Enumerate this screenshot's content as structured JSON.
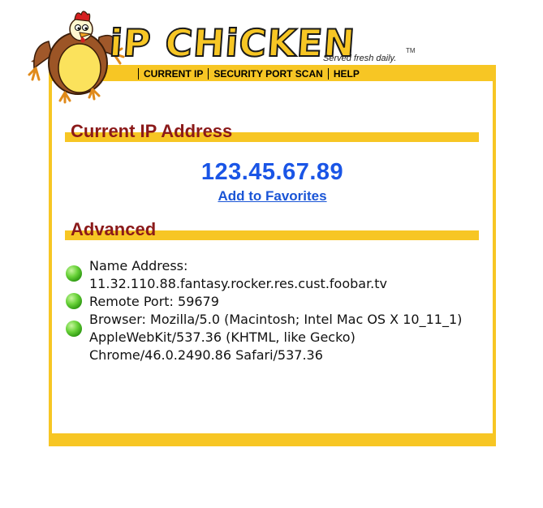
{
  "brand": {
    "wordmark": "iP CHiCKEN",
    "tagline": "Served fresh daily.",
    "trademark": "TM"
  },
  "nav": {
    "items": [
      "CURRENT IP",
      "SECURITY PORT SCAN",
      "HELP"
    ]
  },
  "current_ip": {
    "heading": "Current IP Address",
    "value": "123.45.67.89",
    "favorites_link": "Add to Favorites"
  },
  "advanced": {
    "heading": "Advanced",
    "name_address_label": "Name Address:",
    "name_address_value": "11.32.110.88.fantasy.rocker.res.cust.foobar.tv",
    "remote_port": "Remote Port: 59679",
    "browser": "Browser: Mozilla/5.0 (Macintosh; Intel Mac OS X 10_11_1) AppleWebKit/537.36 (KHTML, like Gecko) Chrome/46.0.2490.86 Safari/537.36"
  },
  "colors": {
    "brand_yellow": "#f7c624",
    "heading_red": "#8b1a1a",
    "ip_blue": "#1a55e6",
    "bullet_green": "#4cc021"
  },
  "icons": {
    "mascot": "chicken-mascot-icon",
    "bullet": "green-orb-icon"
  }
}
